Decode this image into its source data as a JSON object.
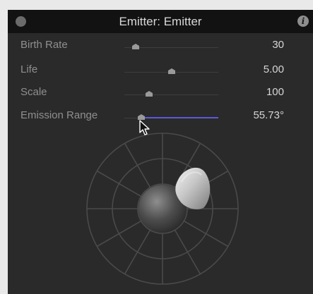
{
  "window": {
    "title": "Emitter: Emitter",
    "close_icon": "close-dot-icon",
    "info_icon": "info-icon",
    "info_glyph": "i"
  },
  "params": [
    {
      "label": "Birth Rate",
      "value": "30",
      "level": 0.12
    },
    {
      "label": "Life",
      "value": "5.00",
      "level": 0.5
    },
    {
      "label": "Scale",
      "value": "100",
      "level": 0.26
    },
    {
      "label": "Emission Range",
      "value": "55.73°",
      "level": 0.18,
      "active": true
    }
  ],
  "colors": {
    "panel": "#2a2a2a",
    "titlebar": "#121212",
    "accent": "#5b5bdc"
  }
}
